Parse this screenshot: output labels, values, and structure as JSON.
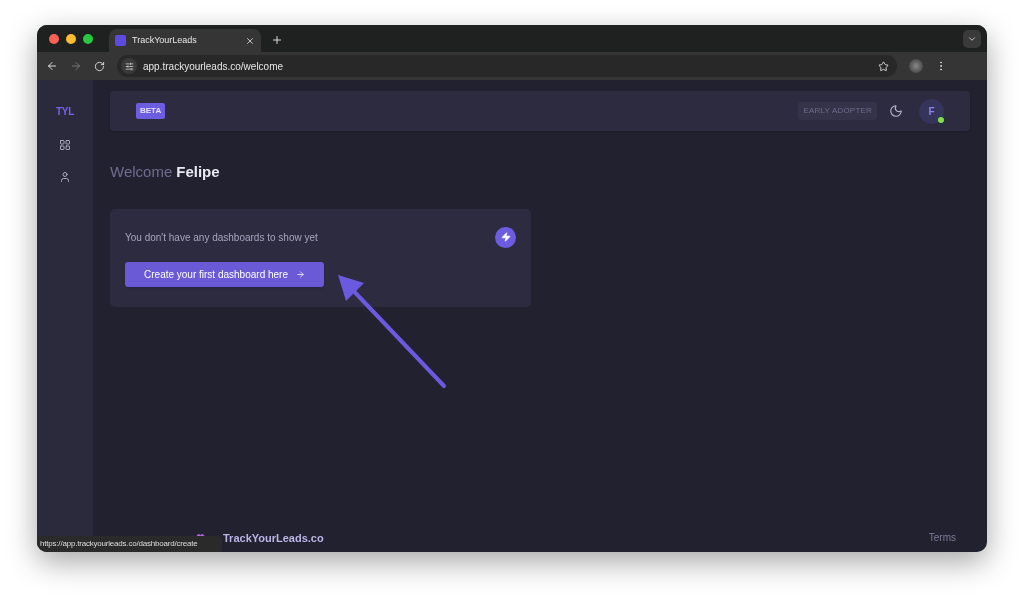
{
  "browser": {
    "tab": {
      "title": "TrackYourLeads"
    },
    "url": "app.trackyourleads.co/welcome",
    "status_url": "https://app.trackyourleads.co/dashboard/create"
  },
  "sidebar": {
    "logo": "TYL",
    "items": [
      {
        "kind": "grid",
        "selected": false
      },
      {
        "kind": "user",
        "selected": false
      }
    ]
  },
  "header": {
    "badge": "BETA",
    "tag": "EARLY ADOPTER",
    "avatar": {
      "initial": "F",
      "online": true
    }
  },
  "welcome": {
    "greeting": "Welcome",
    "name": "Felipe"
  },
  "empty_card": {
    "message": "You don't have any dashboards to show yet",
    "button": "Create your first dashboard here"
  },
  "footer": {
    "brand": "TrackYourLeads.co",
    "link": "Terms"
  }
}
